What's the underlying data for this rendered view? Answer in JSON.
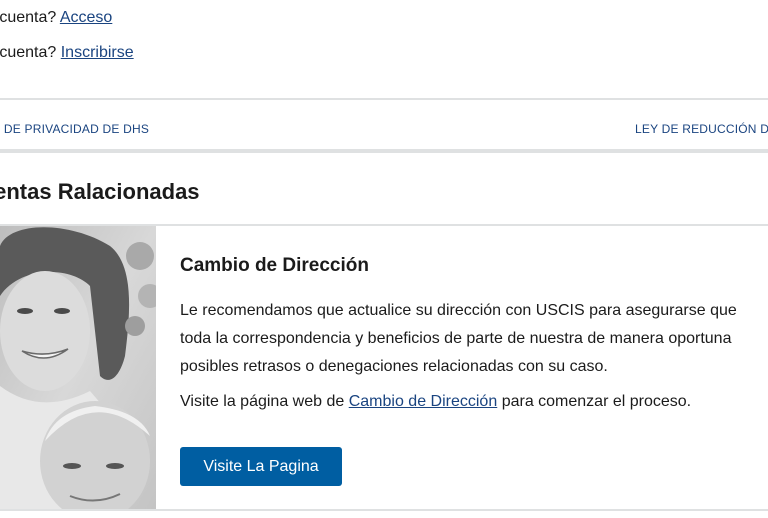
{
  "account": {
    "login_prefix": "a cuenta?",
    "login_link": "Acceso",
    "signup_prefix": "a cuenta?",
    "signup_link": "Inscribirse"
  },
  "footer_links": {
    "privacy": "ÓN DE PRIVACIDAD DE DHS",
    "paperwork": "LEY DE REDUCCIÓN D"
  },
  "related_tools": {
    "title": "ientas Ralacionadas",
    "card": {
      "image_alt": "Mujer sonriente con hombre mayor",
      "heading": "Cambio de Dirección",
      "body_lines": [
        "Le recomendamos que actualice su dirección con USCIS para asegurarse que",
        "toda la correspondencia y beneficios de parte de nuestra de manera oportuna",
        "posibles retrasos o denegaciones relacionadas con su caso."
      ],
      "cta_prefix": "Visite la página web de",
      "cta_link": "Cambio de Dirección",
      "cta_suffix": "para comenzar el proceso.",
      "button_label": "Visite La Pagina"
    }
  },
  "colors": {
    "link": "#1a4480",
    "button": "#005ea2",
    "divider": "#dfe1e2"
  }
}
